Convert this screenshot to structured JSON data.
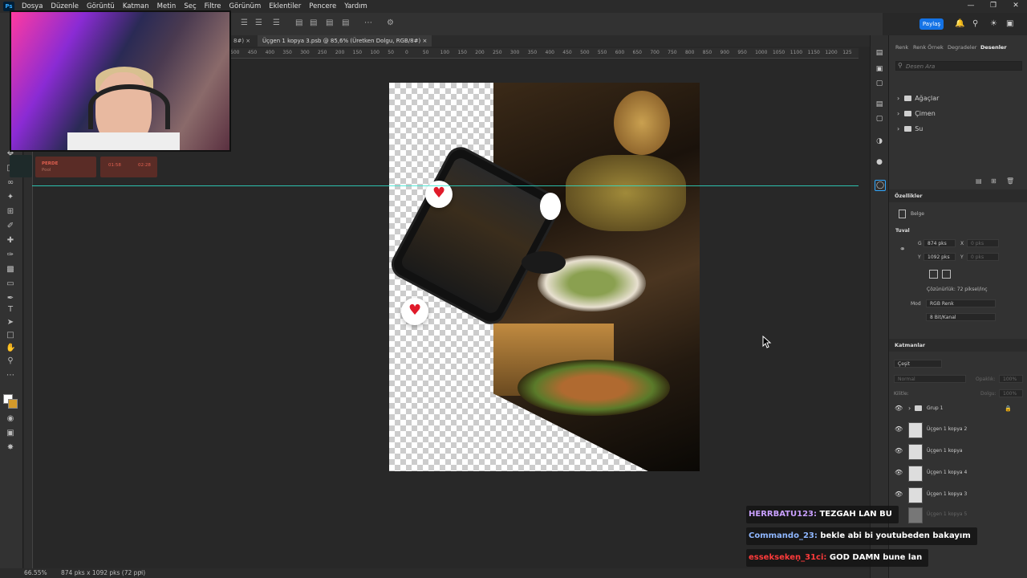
{
  "menu": [
    "Dosya",
    "Düzenle",
    "Görüntü",
    "Katman",
    "Metin",
    "Seç",
    "Filtre",
    "Görünüm",
    "Eklentiler",
    "Pencere",
    "Yardım"
  ],
  "app_logo": "Ps",
  "share_label": "Paylaş",
  "tabs": [
    {
      "label": "8#)"
    },
    {
      "label": "Üçgen 1 kopya 3.psb @ 85,6% (Üretken Dolgu, RGB/8#)"
    }
  ],
  "ruler_ticks": [
    "500",
    "450",
    "400",
    "350",
    "300",
    "250",
    "200",
    "150",
    "100",
    "50",
    "0",
    "50",
    "100",
    "150",
    "200",
    "250",
    "300",
    "350",
    "400",
    "450",
    "500",
    "550",
    "600",
    "650",
    "700",
    "750",
    "800",
    "850",
    "900",
    "950",
    "1000",
    "1050",
    "1100",
    "1150",
    "1200",
    "125"
  ],
  "overlay_cards": [
    {
      "title": "PERDE",
      "sub": "Pool"
    },
    {
      "t1": "01:58",
      "t2": "02:28"
    }
  ],
  "right_panel": {
    "tabs": [
      "Renk",
      "Renk Örnek",
      "Degradeler",
      "Desenler"
    ],
    "search_placeholder": "Desen Ara",
    "folders": [
      "Ağaçlar",
      "Çimen",
      "Su"
    ],
    "properties": {
      "title": "Özellikler",
      "doc_label": "Belge",
      "section": "Tuval",
      "w_label": "G",
      "w_value": "874 pks",
      "h_label": "Y",
      "h_value": "1092 pks",
      "x_label": "X",
      "x_placeholder": "0 pks",
      "y_label": "Y",
      "y_placeholder": "0 pks",
      "resolution": "Çözünürlük: 72 piksel/inç",
      "mode_label": "Mod",
      "mode_value": "RGB Renk",
      "bit_value": "8 Bit/Kanal"
    },
    "layers": {
      "title": "Katmanlar",
      "filter_label": "Çeşit",
      "blend": "Normal",
      "opacity_label": "Opaklık:",
      "opacity_value": "100%",
      "lock_label": "Kilitle:",
      "fill_label": "Dolgu:",
      "fill_value": "100%",
      "items": [
        {
          "name": "Grup 1"
        },
        {
          "name": "Üçgen 1 kopya 2"
        },
        {
          "name": "Üçgen 1 kopya"
        },
        {
          "name": "Üçgen 1 kopya 4"
        },
        {
          "name": "Üçgen 1 kopya 3"
        },
        {
          "name": "Üçgen 1 kopya 5"
        }
      ]
    }
  },
  "status": {
    "zoom": "66.55%",
    "size": "874 pks x 1092 pks (72 ppi)"
  },
  "chat": [
    {
      "user": "HERRBATU123:",
      "msg": "TEZGAH LAN BU",
      "color": "#c9a0ff"
    },
    {
      "user": "Commando_23:",
      "msg": "bekle abi bi youtubeden bakayım",
      "color": "#8fb7ff"
    },
    {
      "user": "esseksekeṇ_31ci:",
      "msg": "GOD DAMN bune lan",
      "color": "#ff3b3b"
    }
  ],
  "colors": {
    "accent": "#1473e6",
    "guide": "#2ee6d0"
  }
}
